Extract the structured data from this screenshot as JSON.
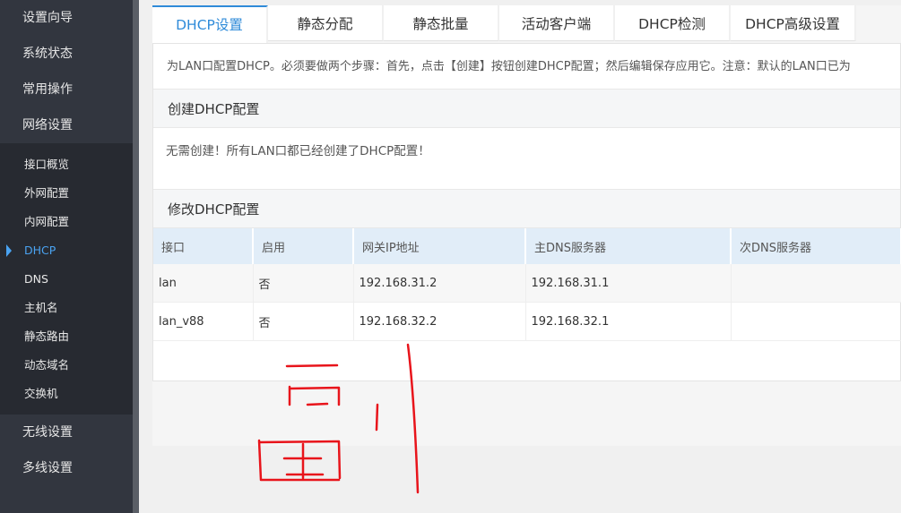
{
  "sidebar": {
    "top_items": [
      {
        "label": "设置向导"
      },
      {
        "label": "系统状态"
      },
      {
        "label": "常用操作"
      },
      {
        "label": "网络设置"
      }
    ],
    "sub_items": [
      {
        "label": "接口概览"
      },
      {
        "label": "外网配置"
      },
      {
        "label": "内网配置"
      },
      {
        "label": "DHCP",
        "active": true
      },
      {
        "label": "DNS"
      },
      {
        "label": "主机名"
      },
      {
        "label": "静态路由"
      },
      {
        "label": "动态域名"
      },
      {
        "label": "交换机"
      }
    ],
    "bottom_items": [
      {
        "label": "无线设置"
      },
      {
        "label": "多线设置"
      }
    ]
  },
  "tabs": [
    {
      "label": "DHCP设置",
      "active": true
    },
    {
      "label": "静态分配"
    },
    {
      "label": "静态批量"
    },
    {
      "label": "活动客户端"
    },
    {
      "label": "DHCP检测"
    },
    {
      "label": "DHCP高级设置"
    }
  ],
  "intro_text": "为LAN口配置DHCP。必须要做两个步骤：首先，点击【创建】按钮创建DHCP配置；然后编辑保存应用它。注意：默认的LAN口已为",
  "create_section": {
    "title": "创建DHCP配置",
    "message": "无需创建！所有LAN口都已经创建了DHCP配置！"
  },
  "modify_section": {
    "title": "修改DHCP配置",
    "columns": [
      "接口",
      "启用",
      "网关IP地址",
      "主DNS服务器",
      "次DNS服务器"
    ],
    "rows": [
      [
        "lan",
        "否",
        "192.168.31.2",
        "192.168.31.1",
        ""
      ],
      [
        "lan_v88",
        "否",
        "192.168.32.2",
        "192.168.32.1",
        ""
      ]
    ]
  },
  "colors": {
    "accent": "#2f8bd9",
    "sidebar_bg": "#32363f",
    "scribble": "#e8141b"
  }
}
